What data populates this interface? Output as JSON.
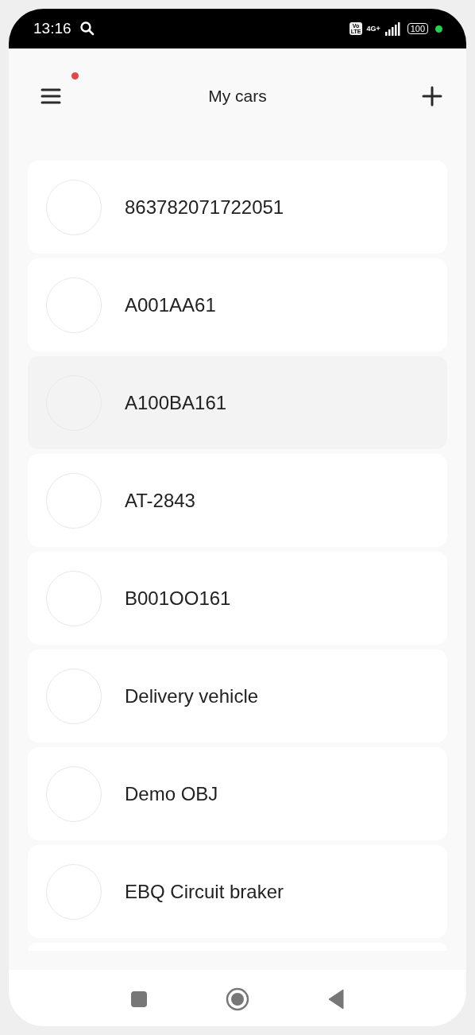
{
  "status_bar": {
    "time": "13:16",
    "volte_top": "Vo",
    "volte_bottom": "LTE",
    "network": "4G+",
    "battery": "100"
  },
  "header": {
    "title": "My cars",
    "notification_dot": true
  },
  "cars": [
    {
      "name": "863782071722051",
      "selected": false
    },
    {
      "name": "A001AA61",
      "selected": false
    },
    {
      "name": "A100BA161",
      "selected": true
    },
    {
      "name": "AT-2843",
      "selected": false
    },
    {
      "name": "B001OO161",
      "selected": false
    },
    {
      "name": "Delivery vehicle",
      "selected": false
    },
    {
      "name": "Demo OBJ",
      "selected": false
    },
    {
      "name": "EBQ Circuit braker",
      "selected": false
    }
  ]
}
